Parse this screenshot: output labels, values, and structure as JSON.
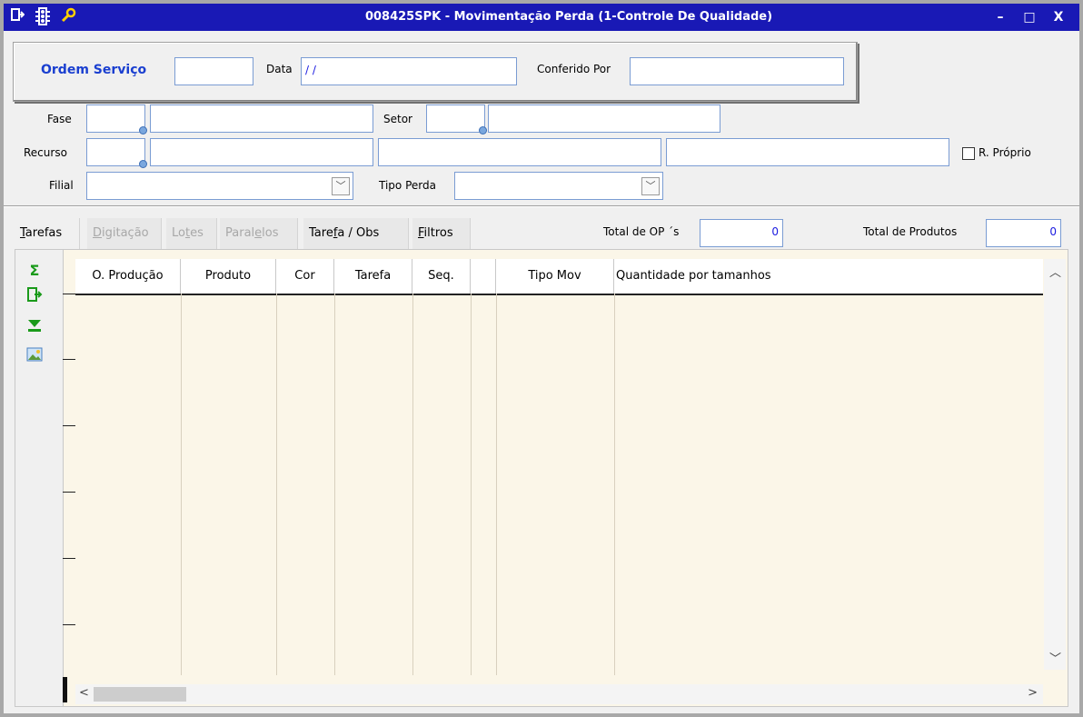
{
  "window": {
    "title": "008425SPK - Movimentação Perda (1-Controle De Qualidade)",
    "minimize": "–",
    "maximize": "□",
    "close": "X"
  },
  "form": {
    "ordem_servico_label": "Ordem Serviço",
    "ordem_servico_value": "",
    "data_label": "Data",
    "data_value": "/ /",
    "conferido_label": "Conferido Por",
    "conferido_value": "",
    "fase_label": "Fase",
    "setor_label": "Setor",
    "recurso_label": "Recurso",
    "r_proprio_label": "R. Próprio",
    "filial_label": "Filial",
    "tipo_perda_label": "Tipo Perda"
  },
  "tabs": [
    {
      "label": "Tarefas",
      "mnemonic_prefix": "",
      "mnemonic": "T",
      "rest": "arefas"
    },
    {
      "label": "Digitação",
      "mnemonic_prefix": "",
      "mnemonic": "D",
      "rest": "igitação"
    },
    {
      "label": "Lotes",
      "mnemonic_prefix": "Lo",
      "mnemonic": "t",
      "rest": "es"
    },
    {
      "label": "Paralelos",
      "mnemonic_prefix": "Paral",
      "mnemonic": "e",
      "rest": "los"
    },
    {
      "label": "Tarefa / Obs",
      "mnemonic_prefix": "Tare",
      "mnemonic": "f",
      "rest": "a / Obs"
    },
    {
      "label": "Filtros",
      "mnemonic_prefix": "",
      "mnemonic": "F",
      "rest": "iltros"
    }
  ],
  "totals": {
    "total_op_label": "Total de OP ´s",
    "total_op_value": "0",
    "total_produtos_label": "Total de Produtos",
    "total_produtos_value": "0"
  },
  "table": {
    "columns": [
      "O. Produção",
      "Produto",
      "Cor",
      "Tarefa",
      "Seq.",
      "",
      "Tipo Mov",
      "Quantidade por tamanhos"
    ]
  },
  "icons": {
    "sum": "sigma-icon",
    "export": "export-icon",
    "download": "download-icon",
    "image": "image-icon"
  },
  "colors": {
    "titlebar": "#1919b5",
    "accent_text": "#1a1ae0",
    "grid_bg": "#fbf6e8"
  }
}
